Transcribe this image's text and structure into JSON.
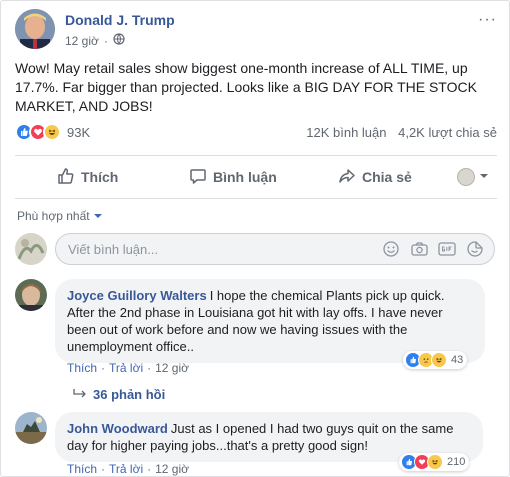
{
  "post": {
    "author": "Donald J. Trump",
    "time": "12 giờ",
    "more_label": "···",
    "text": "Wow! May retail sales show biggest one-month increase of ALL TIME, up 17.7%. Far bigger than projected. Looks like a BIG DAY FOR THE STOCK MARKET, AND JOBS!",
    "reaction_count": "93K",
    "comment_count": "12K bình luận",
    "share_count": "4,2K lượt chia sẻ"
  },
  "actions": {
    "like_label": "Thích",
    "comment_label": "Bình luận",
    "share_label": "Chia sẻ"
  },
  "comments_section": {
    "sort_label": "Phù hợp nhất",
    "compose_placeholder": "Viết bình luận...",
    "replies_label": "36 phản hồi"
  },
  "comments": [
    {
      "author": "Joyce Guillory Walters",
      "text": "I hope the chemical Plants pick up quick. After the 2nd phase in Louisiana got hit with lay offs. I have never been out of work before and now we having issues with the unemployment office..",
      "like_label": "Thích",
      "reply_label": "Trả lời",
      "time": "12 giờ",
      "reaction_count": "43"
    },
    {
      "author": "John Woodward",
      "text": "Just as I opened I had two guys quit on the same day for higher paying jobs...that's a pretty good sign!",
      "like_label": "Thích",
      "reply_label": "Trả lời",
      "time": "12 giờ",
      "reaction_count": "210"
    }
  ],
  "colors": {
    "link_blue": "#385898",
    "meta_gray": "#606770",
    "like_blue": "#2f80ed",
    "love_red": "#f33e58",
    "haha_yellow": "#f7c84b"
  },
  "icons": [
    "globe-icon",
    "more-icon",
    "like-icon",
    "comment-icon",
    "share-icon",
    "caret-down-icon",
    "emoji-icon",
    "camera-icon",
    "gif-icon",
    "sticker-icon",
    "reply-arrow-icon"
  ]
}
